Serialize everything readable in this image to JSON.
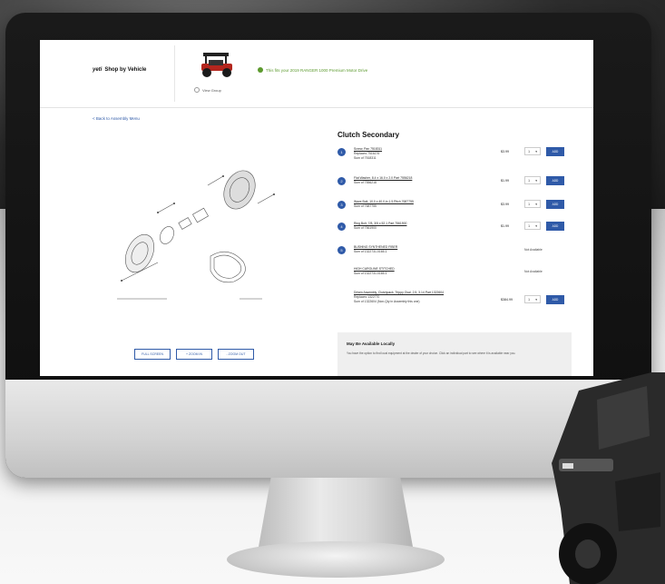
{
  "header": {
    "brand": "yeti",
    "title": "Shop by Vehicle",
    "view_group": "View Group",
    "fitment": "This fits your 2019 RANGER 1000 Premium Motor Drive"
  },
  "nav": {
    "back": "< Back to Assembly Menu"
  },
  "section": {
    "title": "Clutch Secondary"
  },
  "parts": [
    {
      "num": "1",
      "name": "Screw, Pan 7518311",
      "sub1": "Replaces 7516176",
      "sub2": "Sum of 7518311",
      "price": "$3.99",
      "qty": "1",
      "action": "ADD"
    },
    {
      "num": "2",
      "name": "Flat Washer, 8.4 x 16.0 x 2.0 Part 7556218",
      "sub1": "Sum of 7556218",
      "sub2": "",
      "price": "$1.99",
      "qty": "1",
      "action": "ADD"
    },
    {
      "num": "3",
      "name": "Wave Bolt, 10.0 x 40.0 in 1.5 Pitch 7687755",
      "sub1": "Sum of 7687755",
      "sub2": "",
      "price": "$3.99",
      "qty": "1",
      "action": "ADD"
    },
    {
      "num": "4",
      "name": "Ring Bolt, 7/8, 3/5 x 52.1 Part 7561900",
      "sub1": "Sum of 7561900",
      "sub2": "",
      "price": "$1.99",
      "qty": "1",
      "action": "ADD"
    },
    {
      "num": "5",
      "name": "BUSHING SYNTHENED FIBER",
      "sub1": "Sum of 1322731-0165-1",
      "sub2": "",
      "price": "",
      "qty": "",
      "action": "Not Available"
    },
    {
      "num": "",
      "name": "HIGH CAROLINE STITCHED",
      "sub1": "Sum of 1322731-0165-1",
      "sub2": "",
      "price": "",
      "qty": "",
      "action": "Not Available"
    },
    {
      "num": "",
      "name": "Driven Assembly, Clutchpack, Trippy Oval, 2.5, 3.14 Part 1322604",
      "sub1": "Replaces 1322770",
      "sub2": "Sum of 1322604 (Non-Qty in Assembly this one)",
      "price": "$384.99",
      "qty": "1",
      "action": "ADD"
    }
  ],
  "local": {
    "title": "May Be Available Locally",
    "desc": "You have the option to find local equipment at the dealer of your choice. Click an individual part to see where it is available near you."
  },
  "buttons": [
    "FULL SCREEN",
    "+ ZOOM IN",
    "- ZOOM OUT"
  ],
  "icons": [
    "check-circle-icon",
    "radio-icon",
    "chevron-down-icon"
  ],
  "colors": {
    "accent": "#2f5aa8",
    "fit_green": "#5c9a2e",
    "panel": "#efefef"
  }
}
